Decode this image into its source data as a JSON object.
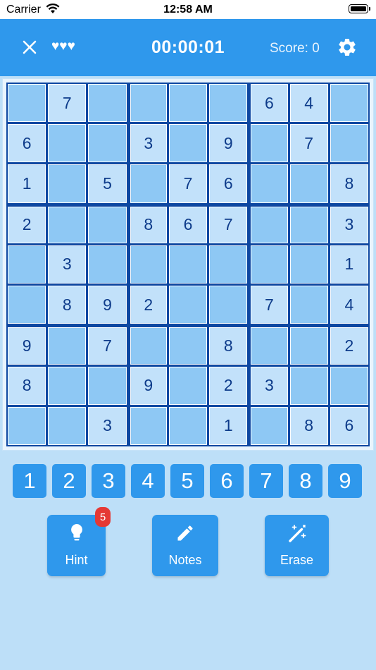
{
  "status_bar": {
    "carrier": "Carrier",
    "time": "12:58 AM"
  },
  "app_bar": {
    "lives": "♥♥♥",
    "timer": "00:00:01",
    "score": "Score: 0"
  },
  "board": {
    "cells": [
      [
        "",
        "7",
        "",
        "",
        "",
        "",
        "6",
        "4",
        ""
      ],
      [
        "6",
        "",
        "",
        "3",
        "",
        "9",
        "",
        "7",
        ""
      ],
      [
        "1",
        "",
        "5",
        "",
        "7",
        "6",
        "",
        "",
        "8"
      ],
      [
        "2",
        "",
        "",
        "8",
        "6",
        "7",
        "",
        "",
        "3"
      ],
      [
        "",
        "3",
        "",
        "",
        "",
        "",
        "",
        "",
        "1"
      ],
      [
        "",
        "8",
        "9",
        "2",
        "",
        "",
        "7",
        "",
        "4"
      ],
      [
        "9",
        "",
        "7",
        "",
        "",
        "8",
        "",
        "",
        "2"
      ],
      [
        "8",
        "",
        "",
        "9",
        "",
        "2",
        "3",
        "",
        ""
      ],
      [
        "",
        "",
        "3",
        "",
        "",
        "1",
        "",
        "8",
        "6"
      ]
    ]
  },
  "numpad": [
    "1",
    "2",
    "3",
    "4",
    "5",
    "6",
    "7",
    "8",
    "9"
  ],
  "actions": {
    "hint": {
      "label": "Hint",
      "badge": "5"
    },
    "notes": {
      "label": "Notes"
    },
    "erase": {
      "label": "Erase"
    }
  },
  "colors": {
    "primary": "#2f98ec",
    "background": "#bddff8",
    "cell_empty": "#8ec8f4",
    "cell_given": "#c2e1fa",
    "grid_border": "#0d47a1",
    "digit": "#0d3b8a",
    "badge": "#e53935"
  }
}
